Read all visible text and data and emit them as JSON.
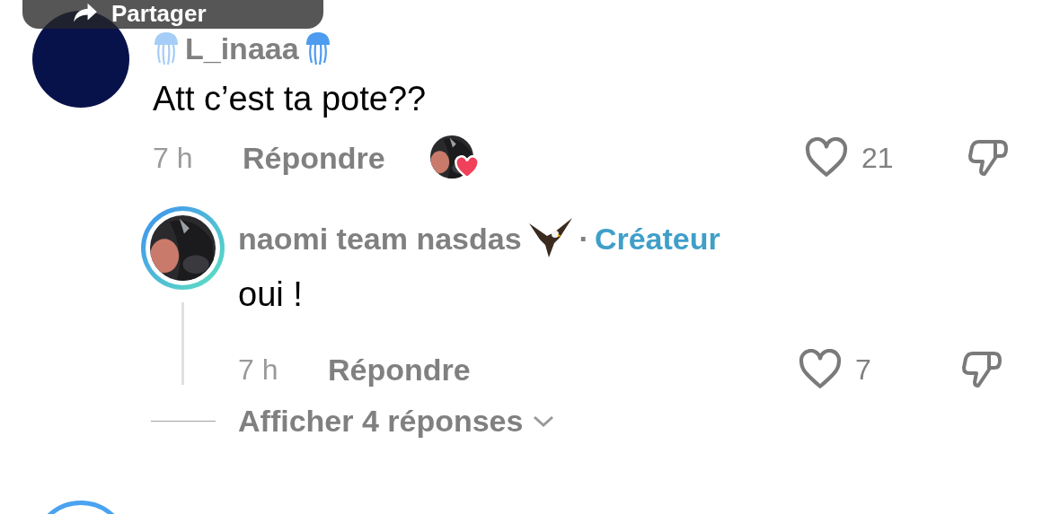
{
  "share_overlay": {
    "label": "Partager"
  },
  "comment": {
    "author": "L_inaaa",
    "text": "Att c’est ta pote??",
    "time": "7 h",
    "reply_label": "Répondre",
    "liked_by_creator": true,
    "likes": "21",
    "liked": false,
    "disliked": false
  },
  "replies": [
    {
      "author": "naomi team nasdas",
      "separator": "·",
      "badge": "Créateur",
      "text": "oui !",
      "time": "7 h",
      "reply_label": "Répondre",
      "likes": "7",
      "liked": false,
      "disliked": false
    }
  ],
  "more_replies": {
    "label": "Afficher 4 réponses"
  }
}
